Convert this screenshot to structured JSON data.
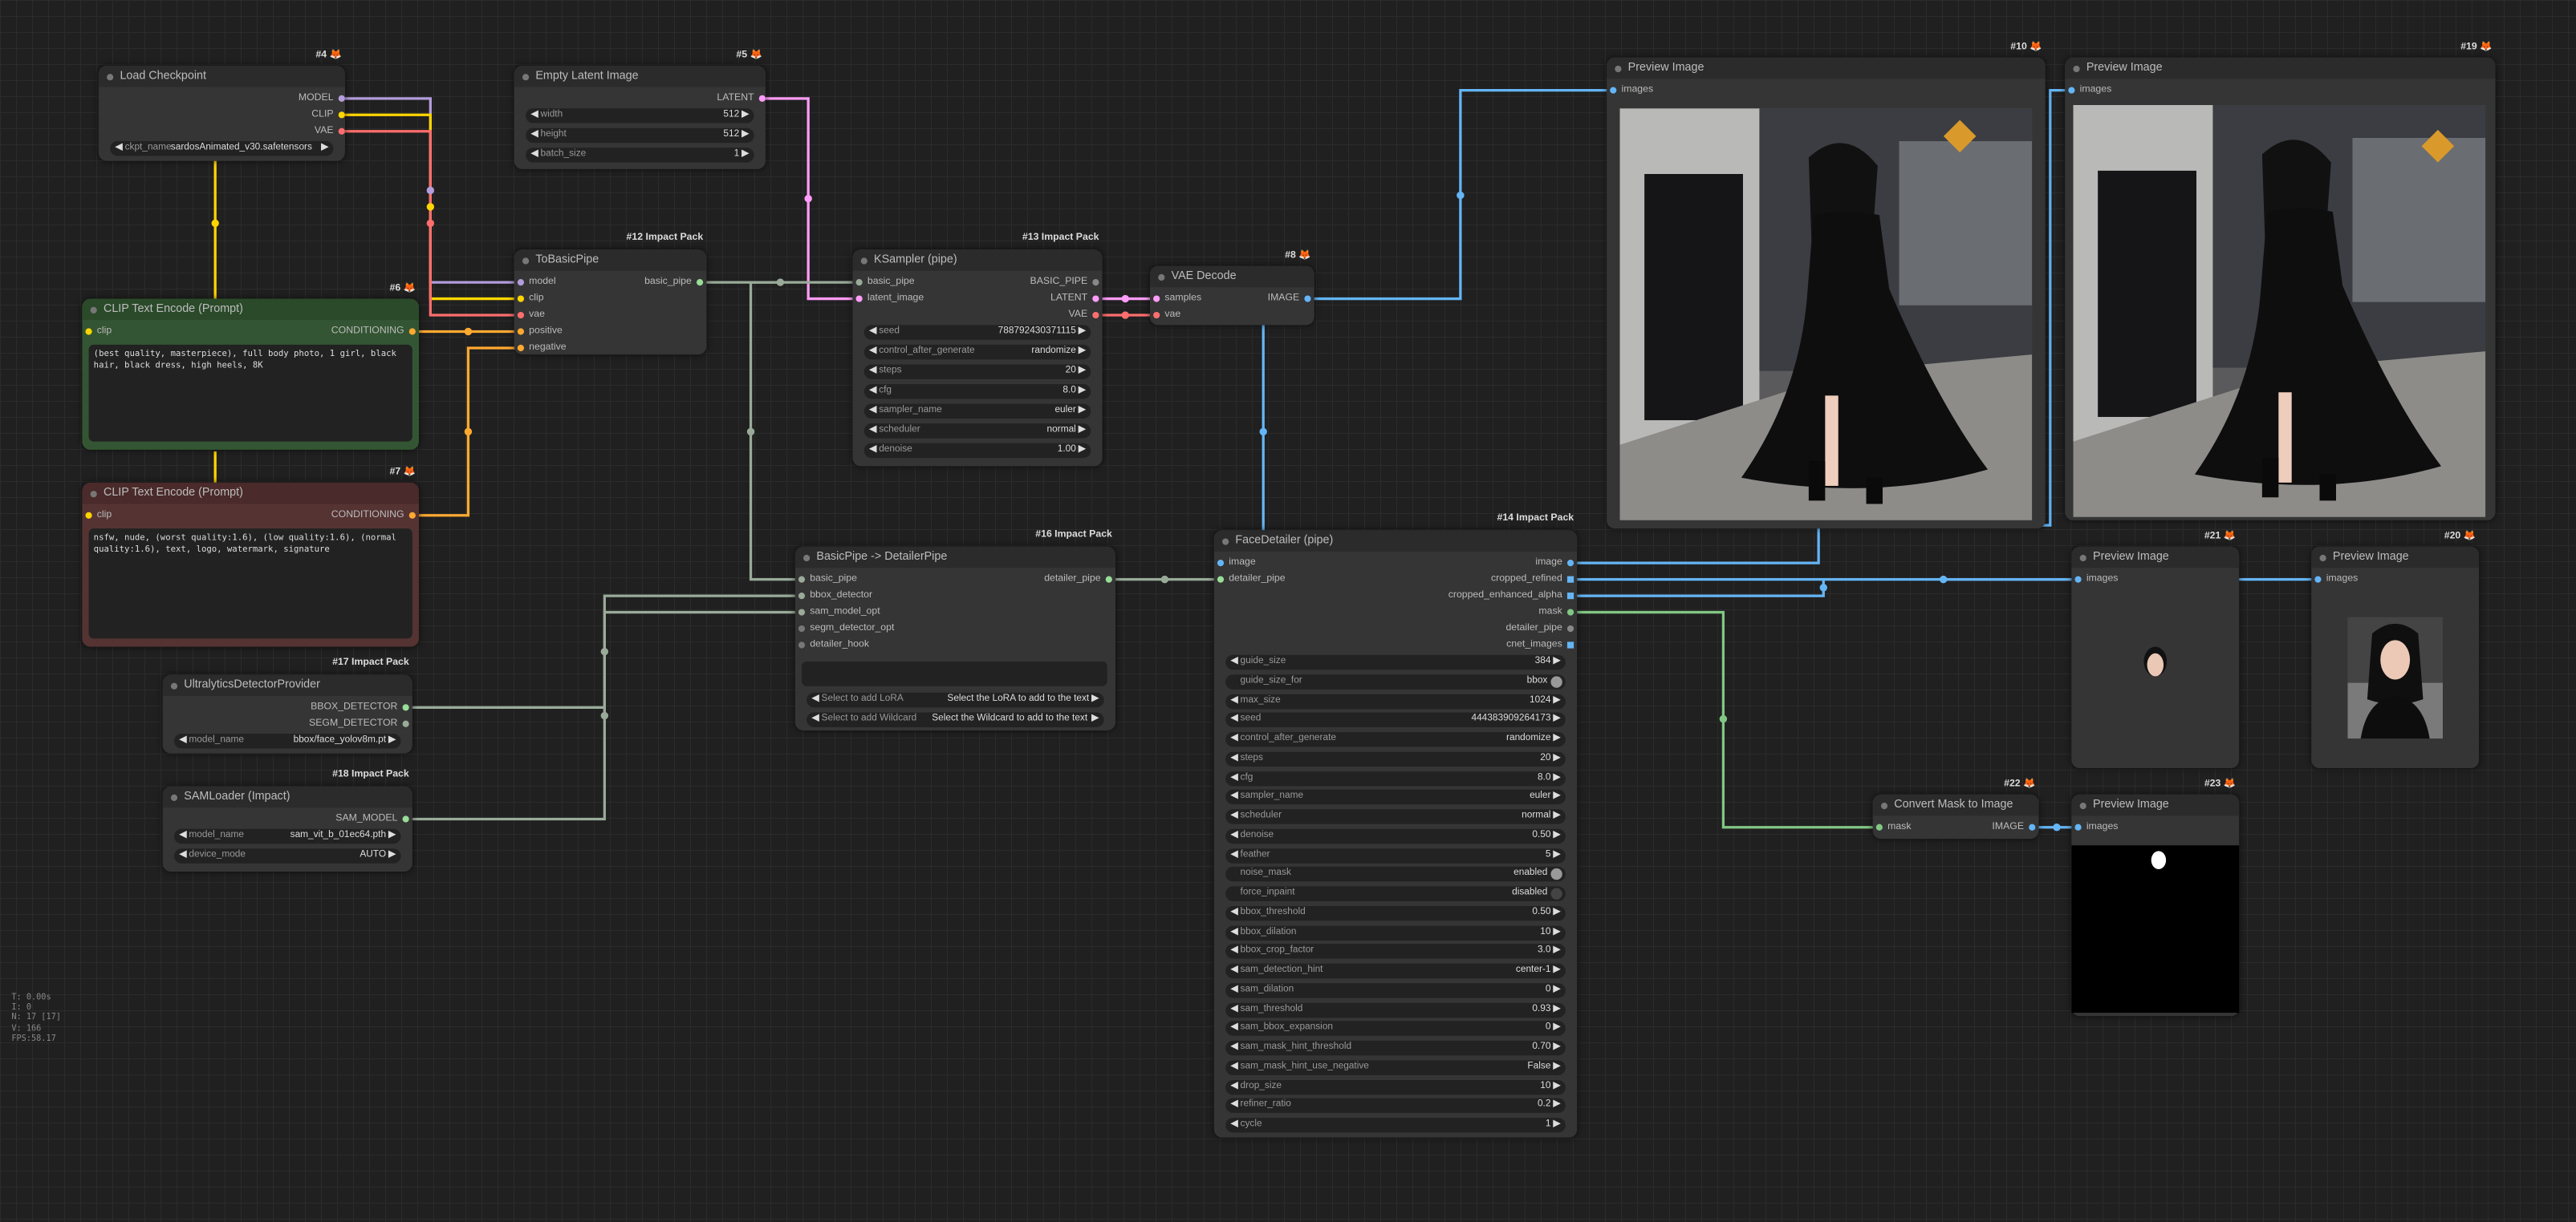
{
  "nodes": {
    "n4": {
      "title": "Load Checkpoint",
      "badge": "#4",
      "outputs": [
        "MODEL",
        "CLIP",
        "VAE"
      ],
      "widget_label": "ckpt_name",
      "widget_value": "sardosAnimated_v30.safetensors"
    },
    "n5": {
      "title": "Empty Latent Image",
      "badge": "#5",
      "output": "LATENT",
      "widgets": [
        {
          "label": "width",
          "value": "512"
        },
        {
          "label": "height",
          "value": "512"
        },
        {
          "label": "batch_size",
          "value": "1"
        }
      ]
    },
    "n6": {
      "title": "CLIP Text Encode (Prompt)",
      "badge": "#6",
      "input": "clip",
      "output": "CONDITIONING",
      "text": "(best quality, masterpiece), full body photo, 1 girl, black hair, black dress, high heels, 8K"
    },
    "n7": {
      "title": "CLIP Text Encode (Prompt)",
      "badge": "#7",
      "input": "clip",
      "output": "CONDITIONING",
      "text": "nsfw, nude, (worst quality:1.6), (low quality:1.6), (normal quality:1.6), text, logo, watermark, signature"
    },
    "n12": {
      "title": "ToBasicPipe",
      "badge": "#12 Impact Pack",
      "inputs": [
        "model",
        "clip",
        "vae",
        "positive",
        "negative"
      ],
      "output": "basic_pipe"
    },
    "n13": {
      "title": "KSampler (pipe)",
      "badge": "#13 Impact Pack",
      "inputs": [
        "basic_pipe",
        "latent_image"
      ],
      "outputs": [
        "BASIC_PIPE",
        "LATENT",
        "VAE"
      ],
      "widgets": [
        {
          "label": "seed",
          "value": "788792430371115"
        },
        {
          "label": "control_after_generate",
          "value": "randomize"
        },
        {
          "label": "steps",
          "value": "20"
        },
        {
          "label": "cfg",
          "value": "8.0"
        },
        {
          "label": "sampler_name",
          "value": "euler"
        },
        {
          "label": "scheduler",
          "value": "normal"
        },
        {
          "label": "denoise",
          "value": "1.00"
        }
      ]
    },
    "n8": {
      "title": "VAE Decode",
      "badge": "#8",
      "inputs": [
        "samples",
        "vae"
      ],
      "output": "IMAGE"
    },
    "n10": {
      "title": "Preview Image",
      "badge": "#10",
      "input": "images"
    },
    "n19": {
      "title": "Preview Image",
      "badge": "#19",
      "input": "images"
    },
    "n16": {
      "title": "BasicPipe -> DetailerPipe",
      "badge": "#16 Impact Pack",
      "inputs": [
        "basic_pipe",
        "bbox_detector",
        "sam_model_opt",
        "segm_detector_opt",
        "detailer_hook"
      ],
      "output": "detailer_pipe",
      "lora_label": "Select to add LoRA",
      "lora_value": "Select the LoRA to add to the text",
      "wild_label": "Select to add Wildcard",
      "wild_value": "Select the Wildcard to add to the text"
    },
    "n17": {
      "title": "UltralyticsDetectorProvider",
      "badge": "#17 Impact Pack",
      "outputs": [
        "BBOX_DETECTOR",
        "SEGM_DETECTOR"
      ],
      "widget_label": "model_name",
      "widget_value": "bbox/face_yolov8m.pt"
    },
    "n18": {
      "title": "SAMLoader (Impact)",
      "badge": "#18 Impact Pack",
      "output": "SAM_MODEL",
      "widgets": [
        {
          "label": "model_name",
          "value": "sam_vit_b_01ec64.pth"
        },
        {
          "label": "device_mode",
          "value": "AUTO"
        }
      ]
    },
    "n14": {
      "title": "FaceDetailer (pipe)",
      "badge": "#14 Impact Pack",
      "inputs": [
        "image",
        "detailer_pipe"
      ],
      "outputs": [
        "image",
        "cropped_refined",
        "cropped_enhanced_alpha",
        "mask",
        "detailer_pipe",
        "cnet_images"
      ],
      "widgets": [
        {
          "label": "guide_size",
          "value": "384"
        },
        {
          "label": "guide_size_for",
          "value": "bbox",
          "toggle": true
        },
        {
          "label": "max_size",
          "value": "1024"
        },
        {
          "label": "seed",
          "value": "444383909264173"
        },
        {
          "label": "control_after_generate",
          "value": "randomize"
        },
        {
          "label": "steps",
          "value": "20"
        },
        {
          "label": "cfg",
          "value": "8.0"
        },
        {
          "label": "sampler_name",
          "value": "euler"
        },
        {
          "label": "scheduler",
          "value": "normal"
        },
        {
          "label": "denoise",
          "value": "0.50"
        },
        {
          "label": "feather",
          "value": "5"
        },
        {
          "label": "noise_mask",
          "value": "enabled",
          "toggle": true
        },
        {
          "label": "force_inpaint",
          "value": "disabled",
          "toggle": true,
          "off": true
        },
        {
          "label": "bbox_threshold",
          "value": "0.50"
        },
        {
          "label": "bbox_dilation",
          "value": "10"
        },
        {
          "label": "bbox_crop_factor",
          "value": "3.0"
        },
        {
          "label": "sam_detection_hint",
          "value": "center-1"
        },
        {
          "label": "sam_dilation",
          "value": "0"
        },
        {
          "label": "sam_threshold",
          "value": "0.93"
        },
        {
          "label": "sam_bbox_expansion",
          "value": "0"
        },
        {
          "label": "sam_mask_hint_threshold",
          "value": "0.70"
        },
        {
          "label": "sam_mask_hint_use_negative",
          "value": "False"
        },
        {
          "label": "drop_size",
          "value": "10"
        },
        {
          "label": "refiner_ratio",
          "value": "0.2"
        },
        {
          "label": "cycle",
          "value": "1"
        }
      ]
    },
    "n21": {
      "title": "Preview Image",
      "badge": "#21",
      "input": "images"
    },
    "n20": {
      "title": "Preview Image",
      "badge": "#20",
      "input": "images"
    },
    "n22": {
      "title": "Convert Mask to Image",
      "badge": "#22",
      "input": "mask",
      "output": "IMAGE"
    },
    "n23": {
      "title": "Preview Image",
      "badge": "#23",
      "input": "images"
    }
  },
  "stats": [
    "T: 0.00s",
    "I: 0",
    "N: 17 [17]",
    "V: 166",
    "FPS:58.17"
  ],
  "colors": {
    "model": "#b39ddb",
    "clip": "#ffd500",
    "vae": "#ff6e6e",
    "conditioning": "#ffa931",
    "latent": "#ff9cf9",
    "image": "#64b5f6",
    "mask": "#81c784",
    "pipe": "#99aa99"
  }
}
